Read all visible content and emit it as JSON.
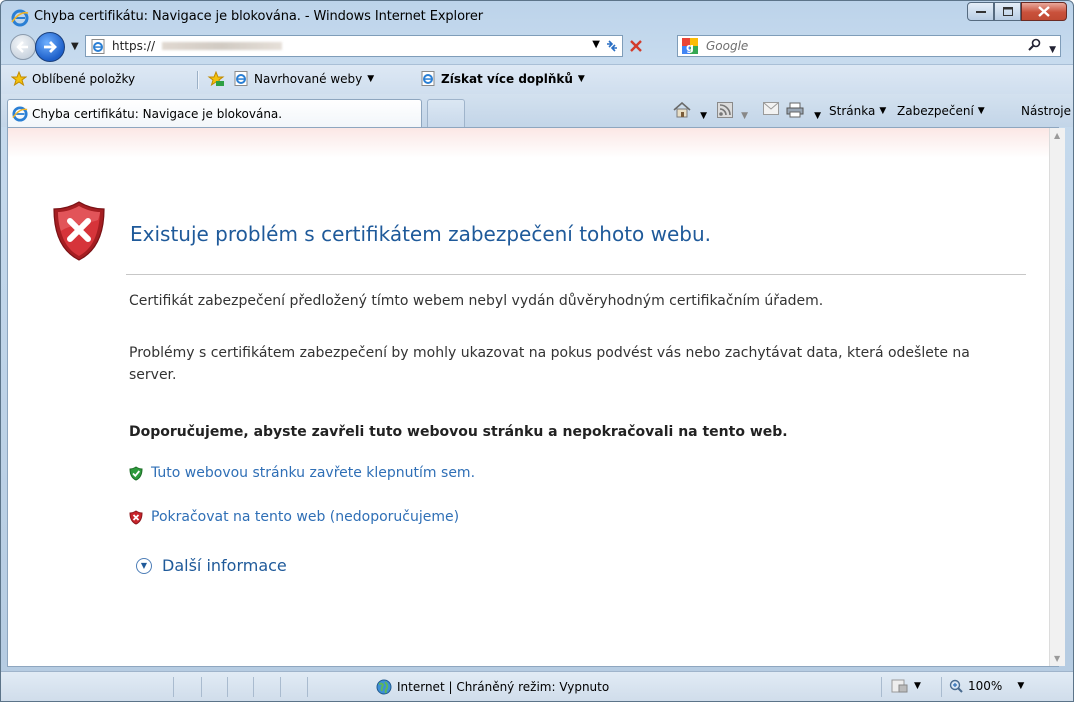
{
  "window": {
    "title": "Chyba certifikátu: Navigace je blokována. - Windows Internet Explorer"
  },
  "address": {
    "url": "https://"
  },
  "search": {
    "placeholder": "Google"
  },
  "favorites": {
    "favorites_label": "Oblíbené položky",
    "suggested_sites": "Navrhované weby",
    "get_addons": "Získat více doplňků"
  },
  "tab": {
    "label": "Chyba certifikátu: Navigace je blokována."
  },
  "commandbar": {
    "page": "Stránka",
    "safety": "Zabezpečení",
    "tools": "Nástroje"
  },
  "content": {
    "heading": "Existuje problém s certifikátem zabezpečení tohoto webu.",
    "para1": "Certifikát zabezpečení předložený tímto webem nebyl vydán důvěryhodným certifikačním úřadem.",
    "para2": "Problémy s certifikátem zabezpečení by mohly ukazovat na pokus podvést vás nebo zachytávat data, která odešlete na server.",
    "recommendation": "Doporučujeme, abyste zavřeli tuto webovou stránku a nepokračovali na tento web.",
    "close_link": "Tuto webovou stránku zavřete klepnutím sem.",
    "continue_link": "Pokračovat na tento web (nedoporučujeme)",
    "more_info": "Další informace"
  },
  "status": {
    "zone": "Internet | Chráněný režim: Vypnuto",
    "zoom": "100%"
  },
  "colors": {
    "heading": "#1f5a9a",
    "link": "#2f6fb6",
    "shield_red": "#c8242b"
  }
}
